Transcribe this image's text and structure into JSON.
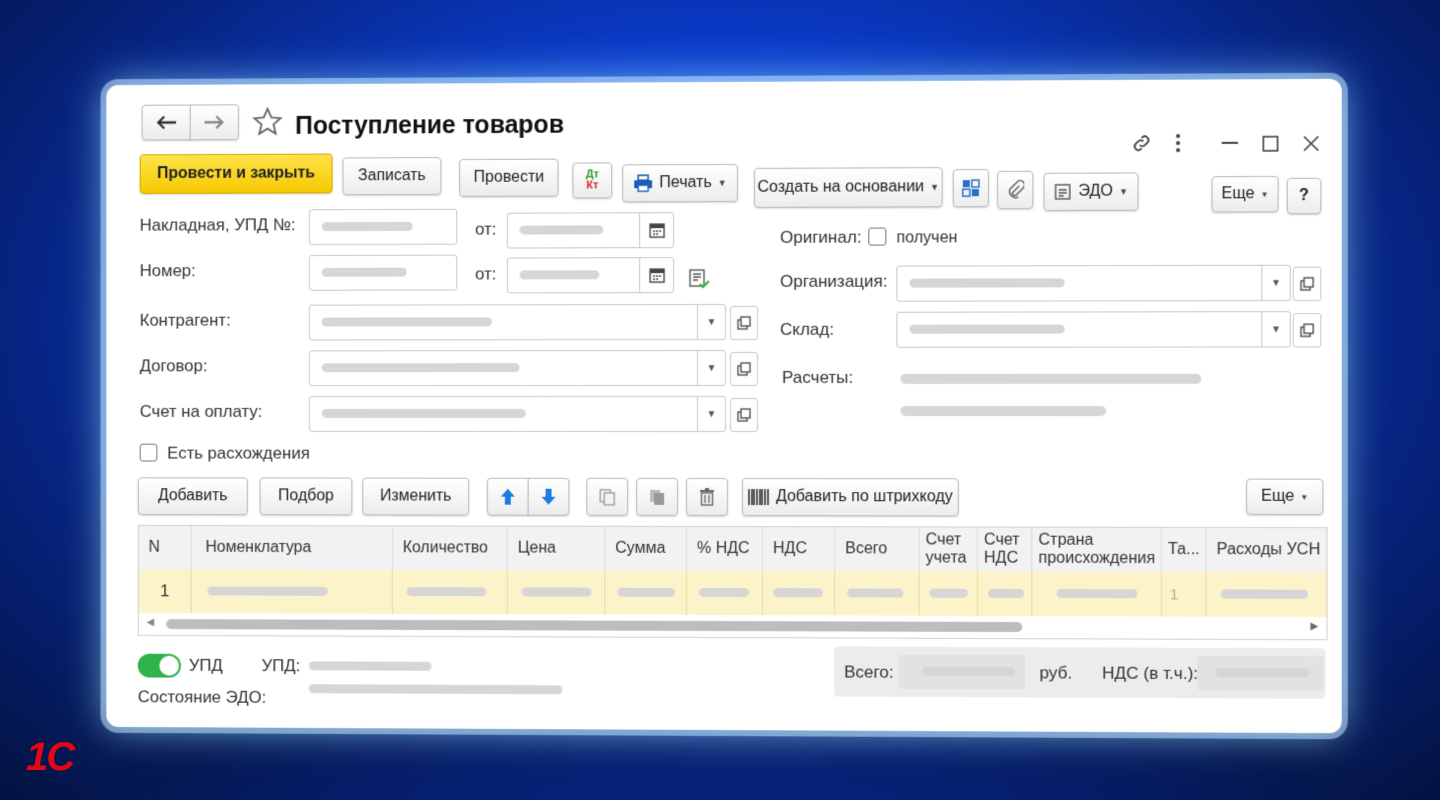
{
  "window": {
    "title": "Поступление товаров"
  },
  "toolbar": {
    "post_close": "Провести и закрыть",
    "save": "Записать",
    "post": "Провести",
    "dtkt_top": "Дт",
    "dtkt_bottom": "Кт",
    "print": "Печать",
    "create_based": "Создать на основании",
    "edo": "ЭДО",
    "more": "Еще",
    "help": "?"
  },
  "form": {
    "invoice_label": "Накладная, УПД №:",
    "from_label": "от:",
    "number_label": "Номер:",
    "counterparty_label": "Контрагент:",
    "contract_label": "Договор:",
    "payment_invoice_label": "Счет на оплату:",
    "discrepancy_label": "Есть расхождения",
    "original_label": "Оригинал:",
    "received_label": "получен",
    "organization_label": "Организация:",
    "warehouse_label": "Склад:",
    "settlements_label": "Расчеты:"
  },
  "table_toolbar": {
    "add": "Добавить",
    "pick": "Подбор",
    "change": "Изменить",
    "barcode": "Добавить по штрихкоду",
    "more": "Еще"
  },
  "table": {
    "columns": [
      "N",
      "Номенклатура",
      "Количество",
      "Цена",
      "Сумма",
      "% НДС",
      "НДС",
      "Всего",
      "Счет учета",
      "Счет НДС",
      "Страна происхождения",
      "Та...",
      "Расходы УСН"
    ],
    "row_number": "1",
    "row_ta_value": "1"
  },
  "footer": {
    "upd_toggle_label": "УПД",
    "upd_label": "УПД:",
    "edo_state_label": "Состояние ЭДО:",
    "total_label": "Всего:",
    "currency": "руб.",
    "vat_label": "НДС (в т.ч.):"
  },
  "brand": {
    "logo_text": "1С"
  },
  "colors": {
    "accent_yellow": "#f5c900",
    "row_highlight": "#fdf3c8",
    "toggle_green": "#2fb34a",
    "logo_red": "#e30613"
  }
}
